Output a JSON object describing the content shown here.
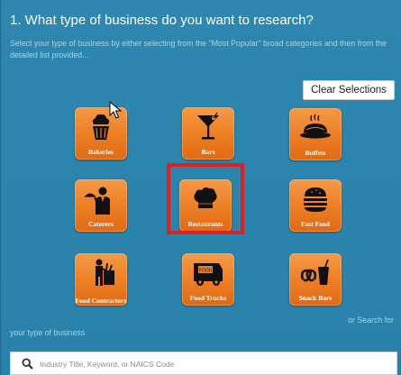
{
  "section": {
    "title": "1. What type of business do you want to research?",
    "instructions": "Select your type of business by either selecting from the \"Most Popular\" broad categories and then from the detailed list provided..."
  },
  "clear_button": {
    "label": "Clear Selections"
  },
  "categories": [
    {
      "label": "Bakeries",
      "icon": "cupcake-icon",
      "selected": false
    },
    {
      "label": "Bars",
      "icon": "cocktail-glass-icon",
      "selected": false
    },
    {
      "label": "Buffets",
      "icon": "pasta-plate-icon",
      "selected": false
    },
    {
      "label": "Caterers",
      "icon": "waiter-icon",
      "selected": false
    },
    {
      "label": "Restaurants",
      "icon": "chef-hat-icon",
      "selected": true
    },
    {
      "label": "Fast Food",
      "icon": "burger-icon",
      "selected": false
    },
    {
      "label": "Food Contractors",
      "icon": "grocery-bag-icon",
      "selected": false
    },
    {
      "label": "Food Trucks",
      "icon": "food-truck-icon",
      "selected": false
    },
    {
      "label": "Snack Bars",
      "icon": "pretzel-drink-icon",
      "selected": false
    }
  ],
  "search": {
    "or_text_1": "or Search for",
    "or_text_2": "your type of business",
    "placeholder": "Industry Title, Keyword, or NAICS Code"
  },
  "colors": {
    "background": "#2e88b0",
    "tile": "#ec7d22",
    "highlight": "#e41d1d",
    "text": "#ffffff",
    "muted_text": "#a9d4e6"
  }
}
